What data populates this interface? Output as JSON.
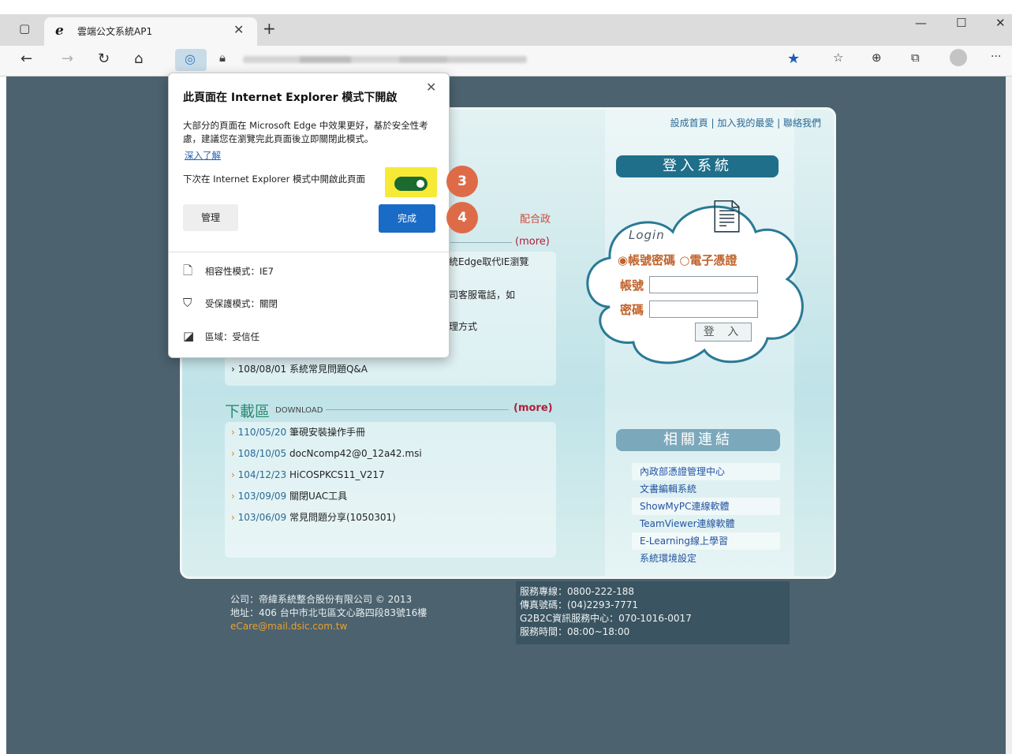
{
  "browser": {
    "tab_title": "雲端公文系統AP1",
    "tab_icon": "ie-logo-icon",
    "window_controls": [
      "—",
      "☐",
      "✕"
    ]
  },
  "popup": {
    "title": "此頁面在 Internet Explorer 模式下開啟",
    "description": "大部分的頁面在 Microsoft Edge 中效果更好，基於安全性考慮，建議您在瀏覽完此頁面後立即關閉此模式。",
    "learn_more": "深入了解",
    "toggle_label": "下次在 Internet Explorer 模式中開啟此頁面",
    "toggle_on": true,
    "manage_label": "管理",
    "done_label": "完成",
    "info_items": [
      {
        "icon": "page-icon",
        "text": "相容性模式：IE7"
      },
      {
        "icon": "shield-icon",
        "text": "受保護模式：關閉"
      },
      {
        "icon": "zone-icon",
        "text": "區域：受信任"
      }
    ]
  },
  "steps": [
    "3",
    "4"
  ],
  "site": {
    "top_links": "設成首頁 | 加入我的最愛 | 聯絡我們",
    "login_title": "登入系統",
    "login_label": "Login",
    "option_account": "◉帳號密碼",
    "option_cert": "○電子憑證",
    "account_label": "帳號",
    "password_label": "密碼",
    "login_button": "登 入",
    "notice_heading": "配合政",
    "notice_more": "(more)",
    "notice_fragments": [
      "系統Edge取代IE瀏覽",
      "公司客服電話，如",
      "處理方式"
    ],
    "notice_last": "› 108/08/01 系統常見問題Q&A",
    "download": {
      "title": "下載區",
      "subtitle": "DOWNLOAD",
      "more": "(more)",
      "items": [
        {
          "date": "110/05/20",
          "text": "筆硯安裝操作手冊"
        },
        {
          "date": "108/10/05",
          "text": "docNcomp42@0_12a42.msi"
        },
        {
          "date": "104/12/23",
          "text": "HiCOSPKCS11_V217"
        },
        {
          "date": "103/09/09",
          "text": "關閉UAC工具"
        },
        {
          "date": "103/06/09",
          "text": "常見問題分享(1050301)"
        }
      ]
    },
    "related_title": "相關連結",
    "related_links": [
      "內政部憑證管理中心",
      "文書編輯系統",
      "ShowMyPC連線軟體",
      "TeamViewer連線軟體",
      "E-Learning線上學習",
      "系統環境設定"
    ],
    "footer_left": [
      "公司：帝緯系統整合股份有限公司 © 2013",
      "地址：406 台中市北屯區文心路四段83號16樓",
      "eCare@mail.dsic.com.tw"
    ],
    "footer_right": [
      "服務專線：0800-222-188",
      "傳真號碼：(04)2293-7771",
      "G2B2C資訊服務中心：070-1016-0017",
      "服務時間：08:00~18:00"
    ]
  },
  "colors": {
    "page_bg": "#4c626f",
    "step_badge": "#de6b48",
    "done_button": "#1a6bc6",
    "toggle_on": "#1b6b2e",
    "toggle_highlight": "#f6ea36"
  }
}
